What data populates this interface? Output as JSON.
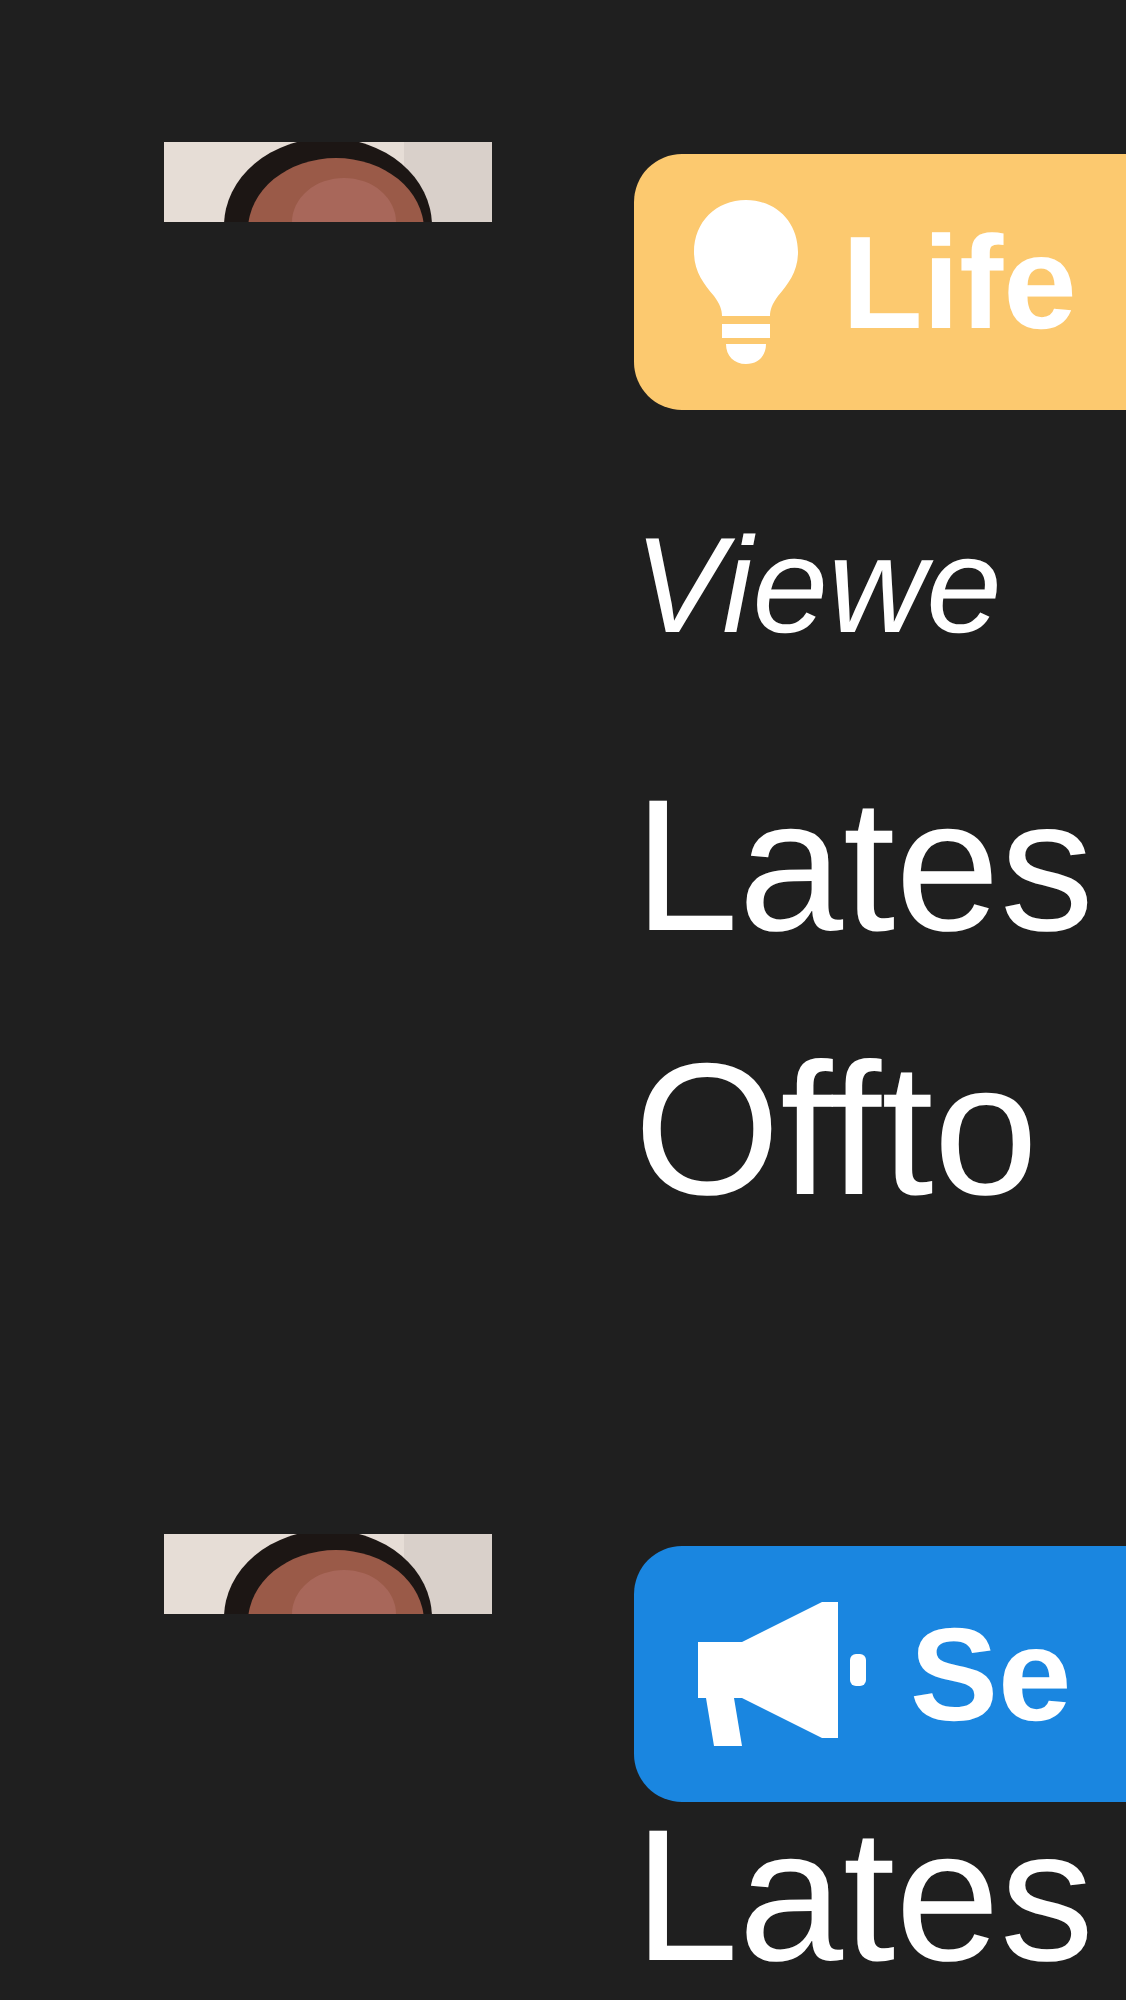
{
  "threads": [
    {
      "avatar": {
        "kind": "picture"
      },
      "tag": {
        "kind": "idea",
        "label": "Life",
        "color": "#fcc96f"
      },
      "lines": [
        {
          "kind": "meta",
          "text": "Viewe"
        },
        {
          "kind": "plain",
          "text": "Lates"
        },
        {
          "kind": "plain",
          "text": "Offto"
        }
      ]
    },
    {
      "avatar": {
        "kind": "picture"
      },
      "tag": {
        "kind": "announcement",
        "label": "Se",
        "color": "#1a86e0"
      },
      "lines": [
        {
          "kind": "plain",
          "text": "Lates"
        }
      ]
    }
  ]
}
